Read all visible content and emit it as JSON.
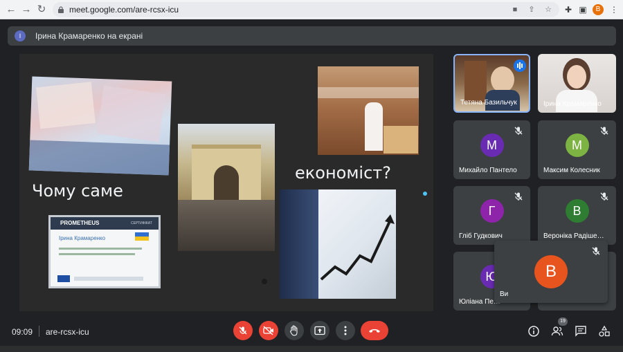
{
  "browser": {
    "url": "meet.google.com/are-rcsx-icu",
    "profile_initial": "B"
  },
  "meeting": {
    "presenter_banner": "Ірина Крамаренко на екрані",
    "presenter_initial": "І",
    "time": "09:09",
    "code": "are-rcsx-icu",
    "participants_count": "19"
  },
  "slide": {
    "title_left": "Чому саме",
    "title_right": "економіст?",
    "certificate": {
      "brand": "PROMETHEUS",
      "label": "СЕРТИФІКАТ",
      "name": "Ірина Крамаренко"
    }
  },
  "participants": [
    {
      "name": "Тетяна Базильчук",
      "initial": "",
      "color": "",
      "speaking": true
    },
    {
      "name": "Ірина Крамаренко",
      "initial": "",
      "color": ""
    },
    {
      "name": "Михайло Пантело",
      "initial": "М",
      "color": "#6a2bb3",
      "muted": true
    },
    {
      "name": "Максим Колесник",
      "initial": "М",
      "color": "#7cb342",
      "muted": true
    },
    {
      "name": "Гліб Гудкович",
      "initial": "Г",
      "color": "#8e24aa",
      "muted": true
    },
    {
      "name": "Вероніка Радіше…",
      "initial": "В",
      "color": "#2e7d32",
      "muted": true
    },
    {
      "name": "Юліана Пе…",
      "initial": "Ю",
      "color": "#6a2bb3",
      "muted": true
    }
  ],
  "self_tile": {
    "name": "Ви",
    "initial": "B",
    "color": "#e8541e"
  },
  "colors": {
    "accent_red": "#ea4335",
    "bar_bg": "#3c4043",
    "speaking_border": "#8ab4f8"
  }
}
